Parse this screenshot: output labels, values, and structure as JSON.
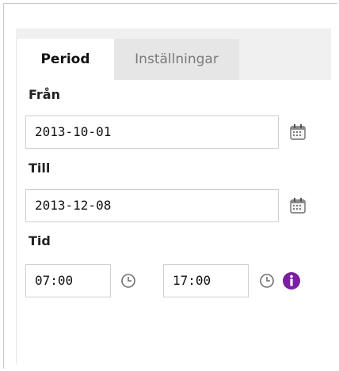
{
  "tabs": {
    "period": "Period",
    "settings": "Inställningar"
  },
  "from": {
    "label": "Från",
    "value": "2013-10-01",
    "icon": "calendar-icon"
  },
  "to": {
    "label": "Till",
    "value": "2013-12-08",
    "icon": "calendar-icon"
  },
  "time": {
    "label": "Tid",
    "start": "07:00",
    "end": "17:00",
    "clock_icon": "clock-icon",
    "info_icon": "info-icon",
    "info_color": "#7a1fa2"
  }
}
